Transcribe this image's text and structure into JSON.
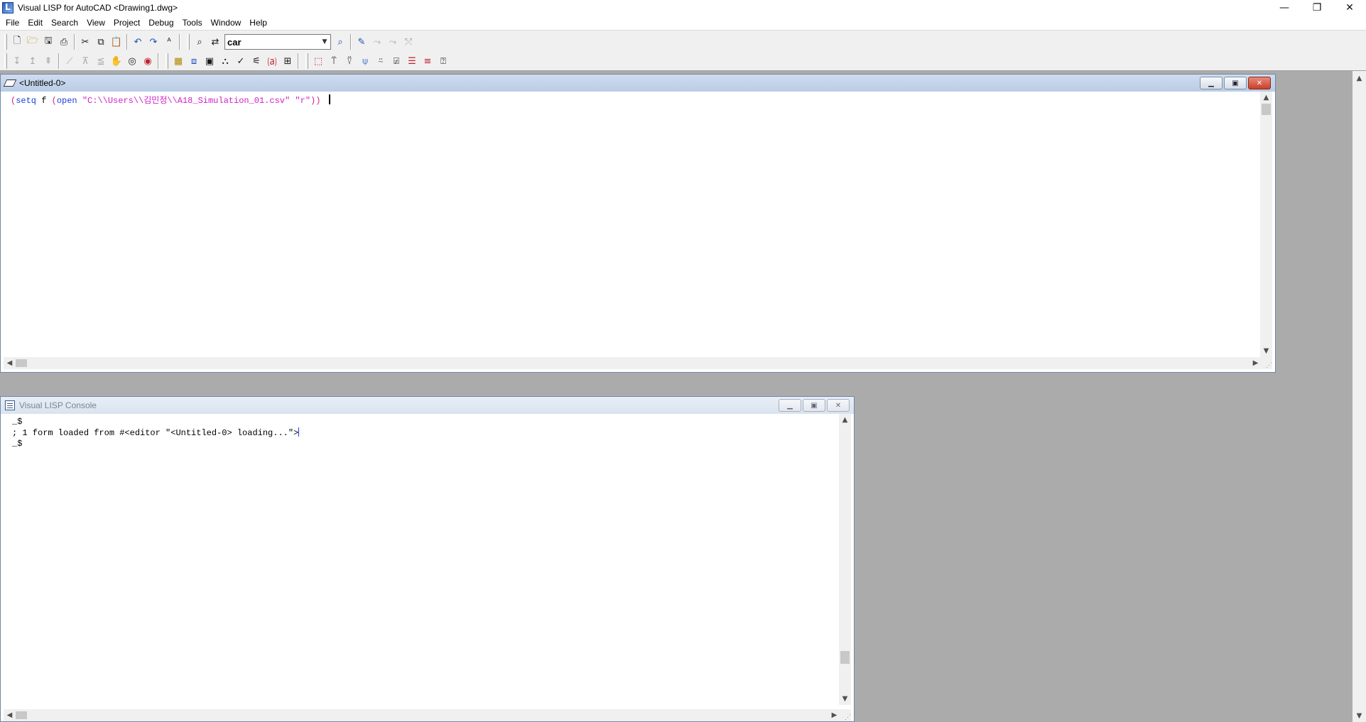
{
  "app": {
    "title": "Visual LISP for AutoCAD <Drawing1.dwg>",
    "controls": {
      "minimize": "—",
      "restore": "❐",
      "close": "✕"
    }
  },
  "menu": [
    "File",
    "Edit",
    "Search",
    "View",
    "Project",
    "Debug",
    "Tools",
    "Window",
    "Help"
  ],
  "toolbar": {
    "search_value": "car"
  },
  "editor": {
    "title": "<Untitled-0>",
    "code": {
      "open1": "(",
      "setq": "setq",
      "var": " f ",
      "open2": "(",
      "fn": "open",
      "path": " \"C:\\\\Users\\\\김민정\\\\A18_Simulation_01.csv\"",
      "mode": " \"r\"",
      "close": "))"
    }
  },
  "console": {
    "title": "Visual LISP Console",
    "lines": [
      "_$",
      "; 1 form loaded from #<editor \"<Untitled-0> loading...\">",
      "_$"
    ]
  },
  "colors": {
    "paren": "#d0208a",
    "keyword": "#1a3fd8",
    "string": "#d020c8",
    "mdi_background": "#ababab"
  }
}
